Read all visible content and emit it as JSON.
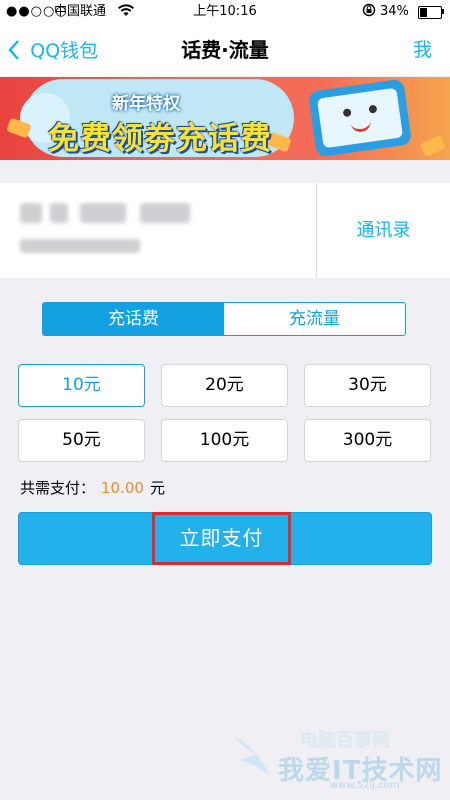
{
  "status_bar": {
    "signal": "●●○○○",
    "carrier": "中国联通",
    "time": "上午10:16",
    "battery": "34%"
  },
  "nav": {
    "back_label": "QQ钱包",
    "title": "话费·流量",
    "right_label": "我"
  },
  "banner": {
    "small_text": "新年特权",
    "big_text": "免费领劵充话费"
  },
  "phone_card": {
    "contacts_label": "通讯录"
  },
  "tabs": [
    {
      "label": "充话费",
      "active": true
    },
    {
      "label": "充流量",
      "active": false
    }
  ],
  "amounts": [
    {
      "label": "10元",
      "selected": true
    },
    {
      "label": "20元",
      "selected": false
    },
    {
      "label": "30元",
      "selected": false
    },
    {
      "label": "50元",
      "selected": false
    },
    {
      "label": "100元",
      "selected": false
    },
    {
      "label": "300元",
      "selected": false
    }
  ],
  "total": {
    "label": "共需支付：",
    "value": "10.00",
    "unit": "元"
  },
  "pay_button": {
    "label": "立即支付"
  },
  "watermark": {
    "top": "电脑百事网",
    "main": "我爱IT技术网",
    "url": "www.52ij.com"
  },
  "colors": {
    "accent": "#12b7f5",
    "tab_active": "#12a2e1",
    "total_value": "#f08a24",
    "pay_button": "#22b1ea",
    "highlight_box": "#e0282e"
  }
}
